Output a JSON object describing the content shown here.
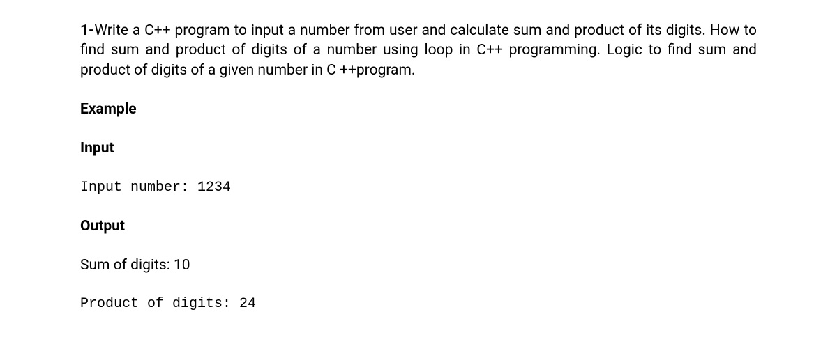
{
  "question": {
    "number": "1-",
    "text": "Write a C++ program to input a number from user and calculate sum and product of its digits. How to find sum and product of digits of a number using loop in C++ programming. Logic to find  sum and product of digits of a given number in C ++program."
  },
  "example_heading": "Example",
  "input_heading": "Input",
  "input_line": "Input number: 1234",
  "output_heading": "Output",
  "sum_line": "Sum of digits: 10",
  "product_line": "Product of digits: 24"
}
